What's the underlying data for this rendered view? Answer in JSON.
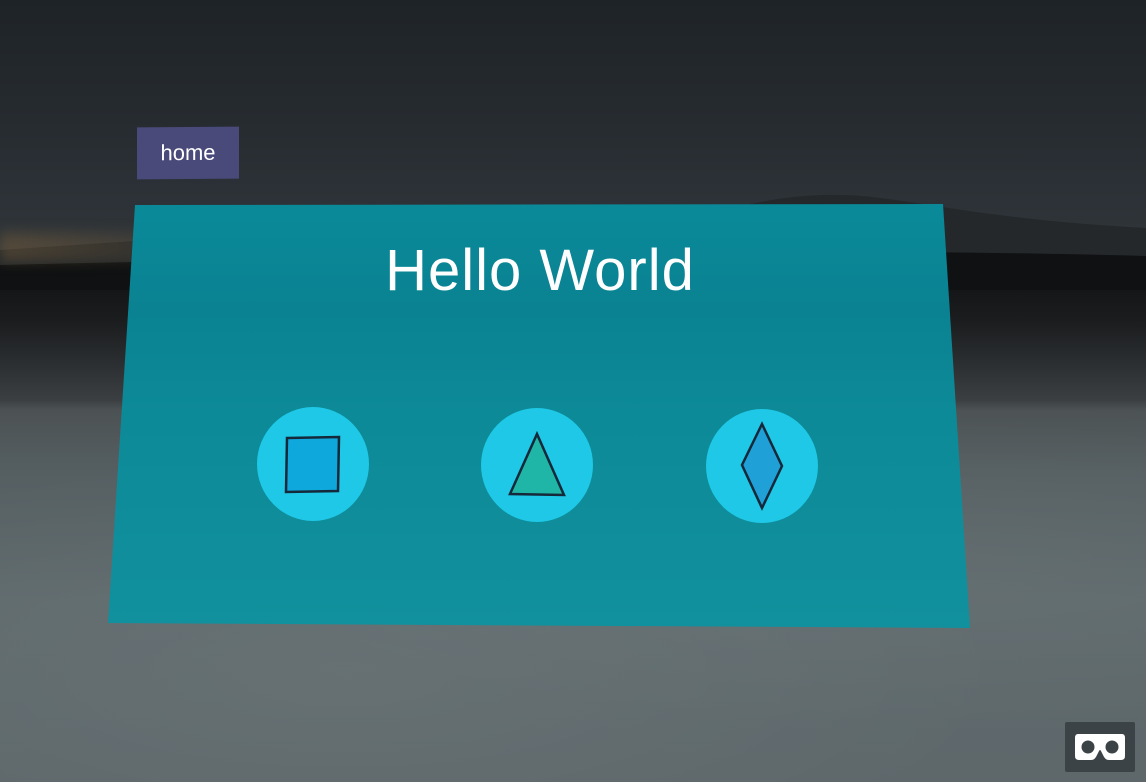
{
  "scene": {
    "home_button": {
      "label": "home"
    },
    "panel": {
      "title": "Hello World",
      "color": "#0a8f9f"
    },
    "shape_buttons": [
      {
        "name": "square",
        "icon": "square-icon",
        "fill": "#0ea8dc"
      },
      {
        "name": "triangle",
        "icon": "triangle-icon",
        "fill": "#1fb6a8"
      },
      {
        "name": "diamond",
        "icon": "diamond-icon",
        "fill": "#1fa1d8"
      }
    ],
    "vr_button": {
      "icon": "vr-headset-icon"
    }
  }
}
